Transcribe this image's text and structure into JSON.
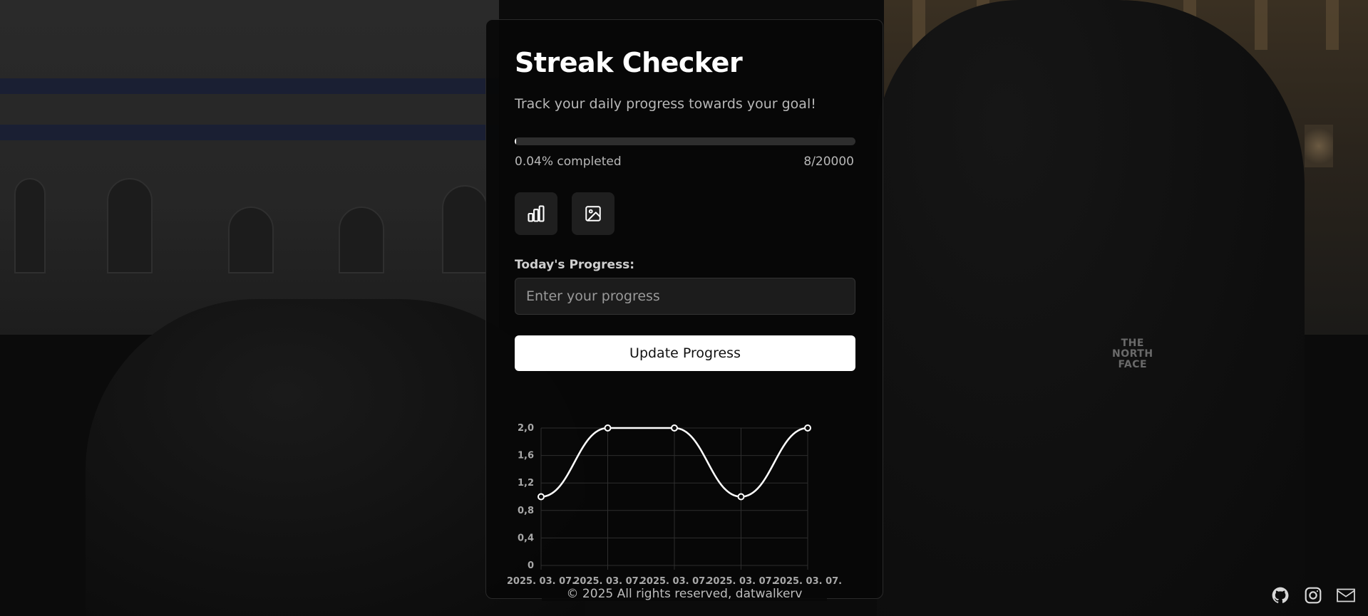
{
  "app": {
    "title": "Streak Checker",
    "subtitle": "Track your daily progress towards your goal!"
  },
  "progress": {
    "completed_text": "0.04% completed",
    "count_text": "8/20000",
    "current": 8,
    "goal": 20000,
    "fraction": 0.0004
  },
  "toolbar": {
    "stats_icon": "bar-chart-icon",
    "image_icon": "image-icon"
  },
  "form": {
    "label": "Today's Progress:",
    "placeholder": "Enter your progress",
    "value": "",
    "submit_label": "Update Progress"
  },
  "chart_data": {
    "type": "line",
    "categories": [
      "2025. 03. 07.",
      "2025. 03. 07.",
      "2025. 03. 07.",
      "2025. 03. 07.",
      "2025. 03. 07."
    ],
    "values": [
      1,
      2,
      2,
      1,
      2
    ],
    "ylim": [
      0,
      2
    ],
    "yticks": [
      "0",
      "0,4",
      "0,8",
      "1,2",
      "1,6",
      "2,0"
    ],
    "ytick_values": [
      0,
      0.4,
      0.8,
      1.2,
      1.6,
      2.0
    ],
    "grid": true,
    "line_color": "#ffffff",
    "grid_color": "#2e2e2e"
  },
  "footer": {
    "text": "© 2025 All rights reserved, datwalkerv"
  },
  "social": {
    "github": "github-icon",
    "instagram": "instagram-icon",
    "mail": "mail-icon"
  },
  "background": {
    "brand_text": "THE\nNORTH\nFACE"
  },
  "colors": {
    "card_bg": "#080808",
    "accent": "#ffffff",
    "muted_text": "#b8b8b8"
  }
}
